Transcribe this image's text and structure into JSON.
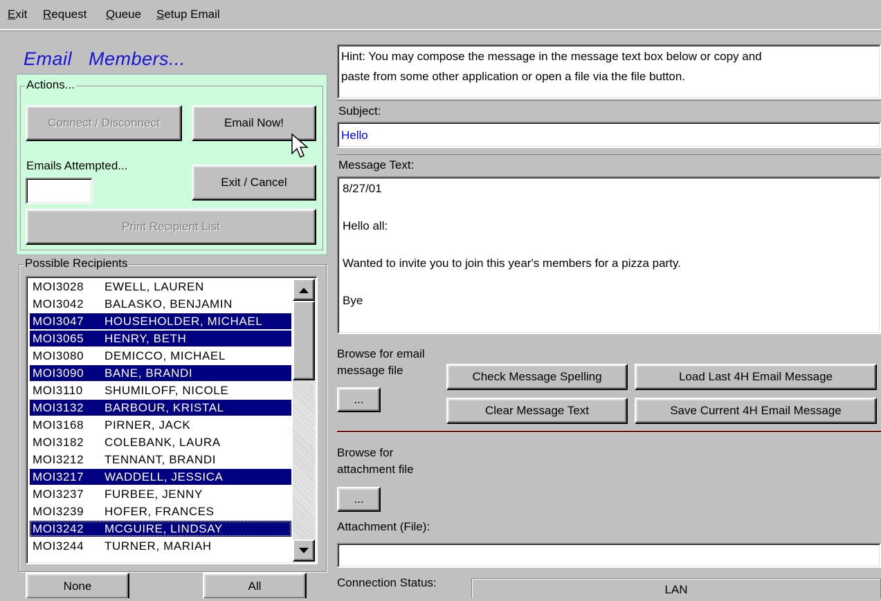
{
  "menu": {
    "exit": "Exit",
    "request": "Request",
    "queue": "Queue",
    "setup_email": "Setup Email"
  },
  "title": "Email   Members...",
  "actions": {
    "group_label": "Actions...",
    "connect_label": "Connect / Disconnect",
    "email_now_label": "Email Now!",
    "emails_attempted_label": "Emails Attempted...",
    "emails_attempted_value": "",
    "exit_cancel_label": "Exit / Cancel",
    "print_list_label": "Print Recipient List"
  },
  "recipients": {
    "group_label": "Possible Recipients",
    "rows": [
      {
        "id": "MOI3028",
        "name": "EWELL, LAUREN",
        "selected": false
      },
      {
        "id": "MOI3042",
        "name": "BALASKO, BENJAMIN",
        "selected": false
      },
      {
        "id": "MOI3047",
        "name": "HOUSEHOLDER, MICHAEL",
        "selected": true
      },
      {
        "id": "MOI3065",
        "name": "HENRY, BETH",
        "selected": true
      },
      {
        "id": "MOI3080",
        "name": "DEMICCO, MICHAEL",
        "selected": false
      },
      {
        "id": "MOI3090",
        "name": "BANE, BRANDI",
        "selected": true
      },
      {
        "id": "MOI3110",
        "name": "SHUMILOFF, NICOLE",
        "selected": false
      },
      {
        "id": "MOI3132",
        "name": "BARBOUR, KRISTAL",
        "selected": true
      },
      {
        "id": "MOI3168",
        "name": "PIRNER, JACK",
        "selected": false
      },
      {
        "id": "MOI3182",
        "name": "COLEBANK, LAURA",
        "selected": false
      },
      {
        "id": "MOI3212",
        "name": "TENNANT, BRANDI",
        "selected": false
      },
      {
        "id": "MOI3217",
        "name": "WADDELL, JESSICA",
        "selected": true
      },
      {
        "id": "MOI3237",
        "name": "FURBEE, JENNY",
        "selected": false
      },
      {
        "id": "MOI3239",
        "name": "HOFER, FRANCES",
        "selected": false
      },
      {
        "id": "MOI3242",
        "name": "MCGUIRE, LINDSAY",
        "selected": true
      },
      {
        "id": "MOI3244",
        "name": "TURNER, MARIAH",
        "selected": false
      }
    ],
    "none_label": "None",
    "all_label": "All"
  },
  "hint": {
    "line1": "Hint:  You may compose the message in the message text box below or copy and",
    "line2": "paste from some other application or open a file via the file button."
  },
  "subject": {
    "label": "Subject:",
    "value": "Hello"
  },
  "message": {
    "label": "Message Text:",
    "lines": [
      "8/27/01",
      "",
      "Hello all:",
      "",
      "Wanted to invite you to join this year's members for a pizza party.",
      "",
      "Bye"
    ]
  },
  "browse_message": {
    "label_line1": "Browse for email",
    "label_line2": "message file",
    "button_label": "..."
  },
  "buttons": {
    "check_spelling": "Check Message Spelling",
    "clear_text": "Clear Message Text",
    "load_last": "Load Last 4H Email Message",
    "save_current": "Save Current 4H Email Message"
  },
  "browse_attachment": {
    "label_line1": "Browse for",
    "label_line2": "attachment file",
    "button_label": "..."
  },
  "attachment": {
    "label": "Attachment (File):",
    "value": ""
  },
  "connection": {
    "label": "Connection Status:",
    "value": "LAN"
  },
  "colors": {
    "actions_panel_bg": "#ccfcdc",
    "selection_bg": "#000080",
    "title_color": "#1515d8",
    "subject_text_color": "#0000ff",
    "separator_color": "#800000"
  }
}
